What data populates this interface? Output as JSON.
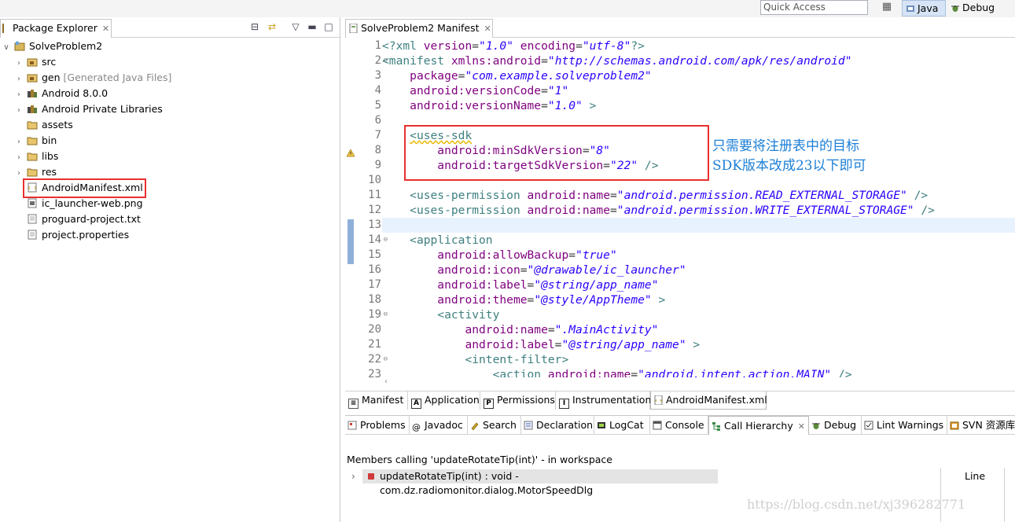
{
  "toolbar": {
    "quick_access_placeholder": "Quick Access",
    "perspectives": [
      {
        "label": "Java",
        "icon": "java-perspective-icon",
        "active": true
      },
      {
        "label": "Debug",
        "icon": "debug-perspective-icon",
        "active": false
      }
    ]
  },
  "package_explorer": {
    "tab_label": "Package Explorer",
    "tree": [
      {
        "label": "SolveProblem2",
        "icon": "project-icon",
        "expanded": true,
        "level": 0
      },
      {
        "label": "src",
        "icon": "source-folder-icon",
        "level": 1
      },
      {
        "label": "gen",
        "decoration": "[Generated Java Files]",
        "icon": "source-folder-icon",
        "level": 1
      },
      {
        "label": "Android 8.0.0",
        "icon": "library-icon",
        "level": 1
      },
      {
        "label": "Android Private Libraries",
        "icon": "library-icon",
        "level": 1
      },
      {
        "label": "assets",
        "icon": "folder-icon",
        "level": 1
      },
      {
        "label": "bin",
        "icon": "folder-icon",
        "level": 1
      },
      {
        "label": "libs",
        "icon": "folder-icon",
        "level": 1
      },
      {
        "label": "res",
        "icon": "folder-icon",
        "level": 1
      },
      {
        "label": "AndroidManifest.xml",
        "icon": "xml-file-icon",
        "level": 1
      },
      {
        "label": "ic_launcher-web.png",
        "icon": "image-file-icon",
        "level": 1
      },
      {
        "label": "proguard-project.txt",
        "icon": "text-file-icon",
        "level": 1
      },
      {
        "label": "project.properties",
        "icon": "text-file-icon",
        "level": 1
      }
    ]
  },
  "editor": {
    "tab_label": "SolveProblem2 Manifest",
    "line_numbers": [
      "1",
      "2",
      "3",
      "4",
      "5",
      "6",
      "7",
      "8",
      "9",
      "10",
      "11",
      "12",
      "13",
      "14",
      "15",
      "16",
      "17",
      "18",
      "19",
      "20",
      "21",
      "22",
      "23"
    ],
    "lines": [
      "<?xml version=\"1.0\" encoding=\"utf-8\"?>",
      "<manifest xmlns:android=\"http://schemas.android.com/apk/res/android\"",
      "    package=\"com.example.solveproblem2\"",
      "    android:versionCode=\"1\"",
      "    android:versionName=\"1.0\" >",
      "",
      "    <uses-sdk",
      "        android:minSdkVersion=\"8\"",
      "        android:targetSdkVersion=\"22\" />",
      "",
      "    <uses-permission android:name=\"android.permission.READ_EXTERNAL_STORAGE\" />",
      "    <uses-permission android:name=\"android.permission.WRITE_EXTERNAL_STORAGE\" />",
      "",
      "    <application",
      "        android:allowBackup=\"true\"",
      "        android:icon=\"@drawable/ic_launcher\"",
      "        android:label=\"@string/app_name\"",
      "        android:theme=\"@style/AppTheme\" >",
      "        <activity",
      "            android:name=\".MainActivity\"",
      "            android:label=\"@string/app_name\" >",
      "            <intent-filter>",
      "                <action android:name=\"android.intent.action.MAIN\" />"
    ],
    "bottom_tabs": [
      {
        "label": "Manifest",
        "icon": "manifest-icon"
      },
      {
        "label": "Application",
        "icon": "application-icon",
        "letter": "A"
      },
      {
        "label": "Permissions",
        "icon": "permissions-icon",
        "letter": "P"
      },
      {
        "label": "Instrumentation",
        "icon": "instrumentation-icon",
        "letter": "I"
      },
      {
        "label": "AndroidManifest.xml",
        "icon": "xml-file-icon",
        "active": true
      }
    ]
  },
  "bottom_view": {
    "tabs": [
      {
        "label": "Problems",
        "icon": "problems-icon"
      },
      {
        "label": "Javadoc",
        "icon": "javadoc-icon"
      },
      {
        "label": "Search",
        "icon": "search-icon"
      },
      {
        "label": "Declaration",
        "icon": "declaration-icon"
      },
      {
        "label": "LogCat",
        "icon": "logcat-icon"
      },
      {
        "label": "Console",
        "icon": "console-icon"
      },
      {
        "label": "Call Hierarchy",
        "icon": "call-hierarchy-icon",
        "active": true
      },
      {
        "label": "Debug",
        "icon": "debug-icon"
      },
      {
        "label": "Lint Warnings",
        "icon": "lint-warnings-icon"
      },
      {
        "label": "SVN 资源库",
        "icon": "svn-repository-icon"
      }
    ],
    "description": "Members calling 'updateRotateTip(int)' - in workspace",
    "caller": "updateRotateTip(int) : void - com.dz.radiomonitor.dialog.MotorSpeedDlg",
    "column_header": "Line"
  },
  "annotation": {
    "line1": "只需要将注册表中的目标",
    "line2": "SDK版本改成23以下即可",
    "color": "#1c7fd6",
    "box_color": "#e8302e"
  },
  "watermark": "https://blog.csdn.net/xj396282771"
}
